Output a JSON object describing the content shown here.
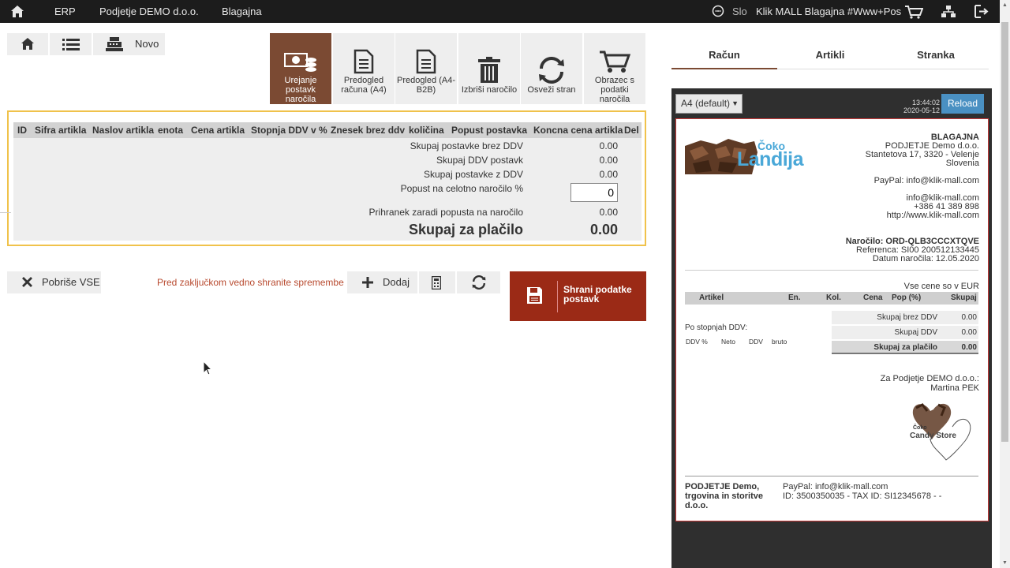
{
  "topbar": {
    "nav": [
      "ERP",
      "Podjetje DEMO d.o.o.",
      "Blagajna"
    ],
    "language": "Slo",
    "pos_title": "Klik MALL Blagajna #Www+Pos"
  },
  "toolbar": {
    "new_label": "Novo",
    "big_buttons": [
      {
        "label": "Urejanje postavk naročila"
      },
      {
        "label": "Predogled računa (A4)"
      },
      {
        "label": "Predogled (A4-B2B)"
      },
      {
        "label": "Izbriši naročilo"
      },
      {
        "label": "Osveži stran"
      },
      {
        "label": "Obrazec s podatki naročila"
      }
    ]
  },
  "table": {
    "columns": [
      "ID",
      "Sifra artikla",
      "Naslov artikla",
      "enota",
      "Cena artikla",
      "Stopnja DDV v %",
      "Znesek brez ddv",
      "količina",
      "Popust postavka",
      "Koncna cena artikla",
      "Del"
    ],
    "sum_net_label": "Skupaj postavke brez DDV",
    "sum_net_value": "0.00",
    "sum_vat_label": "Skupaj DDV postavk",
    "sum_vat_value": "0.00",
    "sum_gross_label": "Skupaj postavke z DDV",
    "sum_gross_value": "0.00",
    "discount_label": "Popust na celotno naročilo %",
    "discount_value": "0",
    "savings_label": "Prihranek zaradi popusta na naročilo",
    "savings_value": "0.00",
    "total_label": "Skupaj za plačilo",
    "total_value": "0.00"
  },
  "actions": {
    "clear_all_label": "Pobriše VSE",
    "warning": "Pred zaključkom vedno shranite spremembe",
    "add_label": "Dodaj",
    "save_label": "Shrani podatke postavk"
  },
  "panel": {
    "tabs": [
      "Račun",
      "Artikli",
      "Stranka"
    ],
    "format_select": "A4 (default)",
    "time": "13:44:02",
    "date": "2020-05-12",
    "reload_label": "Reload",
    "colors": {
      "brand": "#7b4a33",
      "save": "#9b2a16",
      "reload": "#4a90c2",
      "highlight": "#f0c24b"
    }
  },
  "invoice": {
    "logo_text_1": "Čoko",
    "logo_text_2": "Landija",
    "company_title": "BLAGAJNA",
    "company_name": "PODJETJE Demo d.o.o.",
    "address": "Stantetova 17, 3320 - Velenje",
    "country": "Slovenia",
    "paypal": "PayPal: info@klik-mall.com",
    "email": "info@klik-mall.com",
    "phone": "+386 41 389 898",
    "web": "http://www.klik-mall.com",
    "order_no": "Naročilo: ORD-QLB3CCCXTQVE",
    "reference": "Referenca: SI00 200512133445",
    "order_date": "Datum naročila: 12.05.2020",
    "currency_note": "Vse cene so v EUR",
    "article_columns": [
      "Artikel",
      "En.",
      "Kol.",
      "Cena",
      "Pop (%)",
      "Skupaj"
    ],
    "vat_rates_label": "Po stopnjah DDV:",
    "vat_columns": [
      "DDV %",
      "Neto",
      "DDV",
      "bruto"
    ],
    "sum_net_label": "Skupaj brez DDV",
    "sum_net_value": "0.00",
    "sum_vat_label": "Skupaj DDV",
    "sum_vat_value": "0.00",
    "sum_total_label": "Skupaj za plačilo",
    "sum_total_value": "0.00",
    "signed_for": "Za Podjetje DEMO d.o.o.:",
    "signer": "Martina PEK",
    "stamp_small": "Čoko",
    "stamp_text": "Candy Store",
    "footer_company": "PODJETJE Demo, trgovina in storitve d.o.o.",
    "footer_paypal": "PayPal: info@klik-mall.com",
    "footer_ids": "ID: 3500350035 - TAX ID: SI12345678 - -"
  }
}
